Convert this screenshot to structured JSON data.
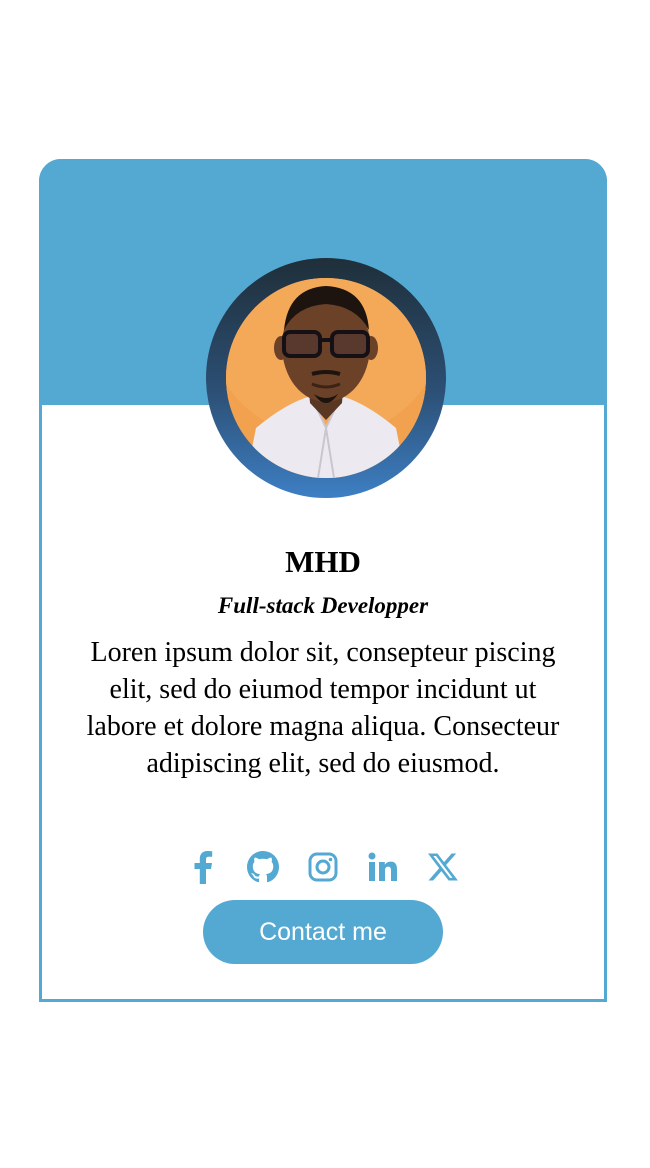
{
  "profile": {
    "name": "MHD",
    "role": "Full-stack Developper",
    "bio": "Loren ipsum dolor sit, consepteur piscing elit, sed do eiumod tempor incidunt ut labore et dolore magna aliqua. Consecteur adipiscing elit, sed do eiusmod."
  },
  "socials": [
    {
      "icon": "facebook-icon"
    },
    {
      "icon": "github-icon"
    },
    {
      "icon": "instagram-icon"
    },
    {
      "icon": "linkedin-icon"
    },
    {
      "icon": "x-icon"
    }
  ],
  "contact_button": {
    "label": "Contact me"
  },
  "colors": {
    "accent": "#54a9d3",
    "avatar_ring_top": "#1f2f3a",
    "avatar_ring_bottom": "#3d7fc4",
    "avatar_bg": "#f0a04d"
  }
}
